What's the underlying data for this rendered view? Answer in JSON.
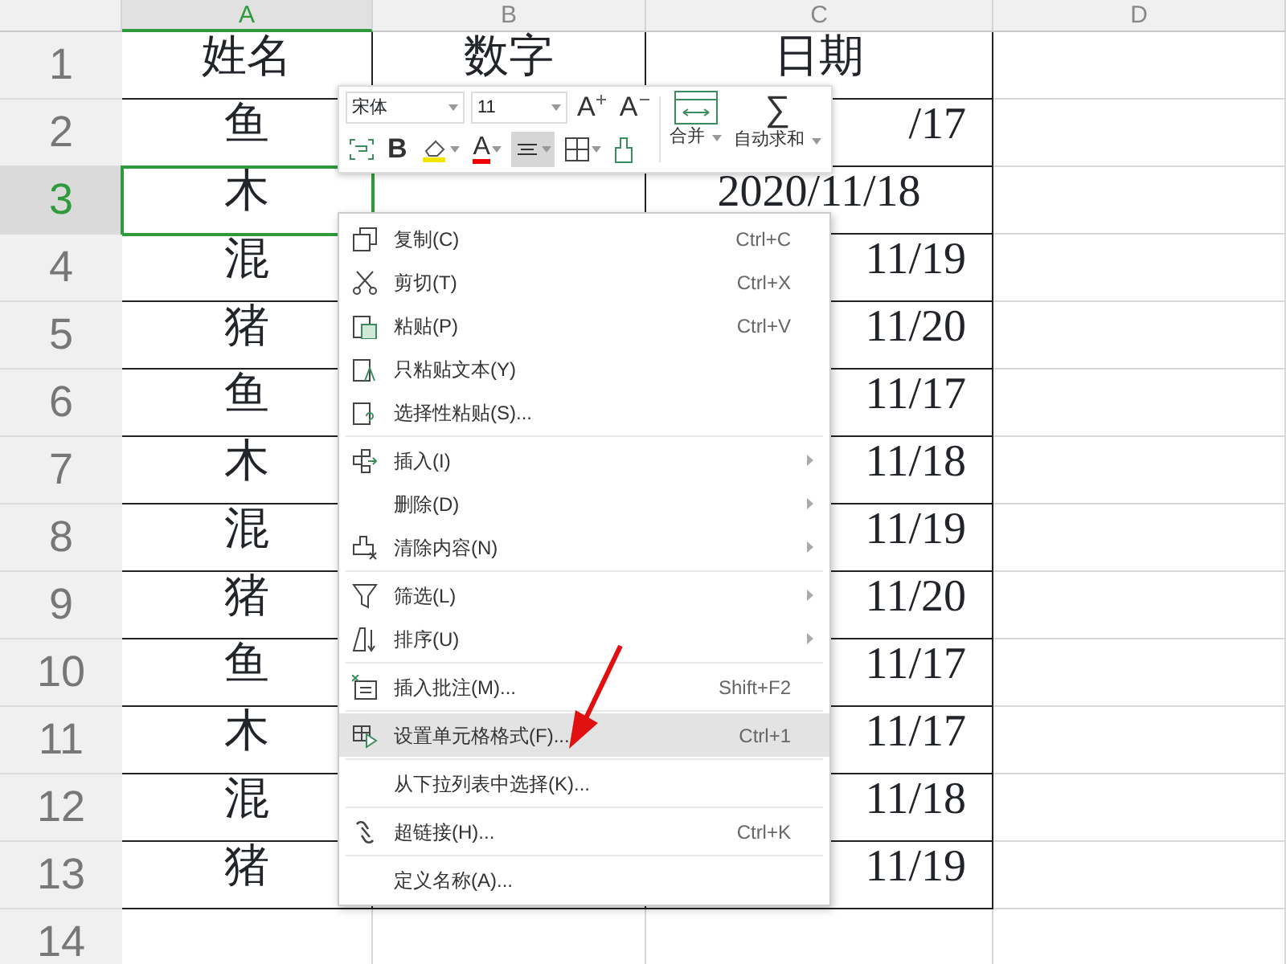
{
  "columns": [
    {
      "label": "A",
      "selected": true
    },
    {
      "label": "B",
      "selected": false
    },
    {
      "label": "C",
      "selected": false
    },
    {
      "label": "D",
      "selected": false
    }
  ],
  "rows": [
    {
      "header": "1",
      "selected": false,
      "cells": [
        {
          "text": "姓名"
        },
        {
          "text": "数字"
        },
        {
          "text": "日期"
        },
        {
          "text": ""
        }
      ]
    },
    {
      "header": "2",
      "selected": false,
      "cells": [
        {
          "text": "鱼"
        },
        {
          "text": ""
        },
        {
          "text": "/17",
          "partial": true
        },
        {
          "text": ""
        }
      ]
    },
    {
      "header": "3",
      "selected": true,
      "cells": [
        {
          "text": "木",
          "selected": true
        },
        {
          "text": ""
        },
        {
          "text": "2020/11/18"
        },
        {
          "text": ""
        }
      ]
    },
    {
      "header": "4",
      "selected": false,
      "cells": [
        {
          "text": "混"
        },
        {
          "text": ""
        },
        {
          "text": "11/19",
          "partial": true
        },
        {
          "text": ""
        }
      ]
    },
    {
      "header": "5",
      "selected": false,
      "cells": [
        {
          "text": "猪"
        },
        {
          "text": ""
        },
        {
          "text": "11/20",
          "partial": true
        },
        {
          "text": ""
        }
      ]
    },
    {
      "header": "6",
      "selected": false,
      "cells": [
        {
          "text": "鱼"
        },
        {
          "text": ""
        },
        {
          "text": "11/17",
          "partial": true
        },
        {
          "text": ""
        }
      ]
    },
    {
      "header": "7",
      "selected": false,
      "cells": [
        {
          "text": "木"
        },
        {
          "text": ""
        },
        {
          "text": "11/18",
          "partial": true
        },
        {
          "text": ""
        }
      ]
    },
    {
      "header": "8",
      "selected": false,
      "cells": [
        {
          "text": "混"
        },
        {
          "text": ""
        },
        {
          "text": "11/19",
          "partial": true
        },
        {
          "text": ""
        }
      ]
    },
    {
      "header": "9",
      "selected": false,
      "cells": [
        {
          "text": "猪"
        },
        {
          "text": ""
        },
        {
          "text": "11/20",
          "partial": true
        },
        {
          "text": ""
        }
      ]
    },
    {
      "header": "10",
      "selected": false,
      "cells": [
        {
          "text": "鱼"
        },
        {
          "text": ""
        },
        {
          "text": "11/17",
          "partial": true
        },
        {
          "text": ""
        }
      ]
    },
    {
      "header": "11",
      "selected": false,
      "cells": [
        {
          "text": "木"
        },
        {
          "text": ""
        },
        {
          "text": "11/17",
          "partial": true
        },
        {
          "text": ""
        }
      ]
    },
    {
      "header": "12",
      "selected": false,
      "cells": [
        {
          "text": "混"
        },
        {
          "text": ""
        },
        {
          "text": "11/18",
          "partial": true
        },
        {
          "text": ""
        }
      ]
    },
    {
      "header": "13",
      "selected": false,
      "cells": [
        {
          "text": "猪"
        },
        {
          "text": ""
        },
        {
          "text": "11/19",
          "partial": true
        },
        {
          "text": ""
        }
      ]
    },
    {
      "header": "14",
      "selected": false,
      "cells": [
        {
          "text": ""
        },
        {
          "text": ""
        },
        {
          "text": ""
        },
        {
          "text": ""
        }
      ]
    }
  ],
  "toolbar": {
    "font_name": "宋体",
    "font_size": "11",
    "grow_font": "A",
    "shrink_font": "A",
    "bold": "B",
    "font_color": "A",
    "align_center_selected": true,
    "merge": "合并",
    "sum_symbol": "∑",
    "autosum": "自动求和"
  },
  "context_menu": [
    [
      {
        "kind": "copy",
        "label": "复制(C)",
        "shortcut": "Ctrl+C",
        "submenu": false,
        "selected": false
      },
      {
        "kind": "cut",
        "label": "剪切(T)",
        "shortcut": "Ctrl+X",
        "submenu": false,
        "selected": false
      },
      {
        "kind": "paste",
        "label": "粘贴(P)",
        "shortcut": "Ctrl+V",
        "submenu": false,
        "selected": false
      },
      {
        "kind": "paste-text",
        "label": "只粘贴文本(Y)",
        "submenu": false,
        "selected": false
      },
      {
        "kind": "paste-special",
        "label": "选择性粘贴(S)...",
        "submenu": false,
        "selected": false
      }
    ],
    [
      {
        "kind": "insert",
        "label": "插入(I)",
        "submenu": true,
        "selected": false
      },
      {
        "kind": "plain",
        "label": "删除(D)",
        "submenu": true,
        "selected": false
      },
      {
        "kind": "clear",
        "label": "清除内容(N)",
        "submenu": true,
        "selected": false
      }
    ],
    [
      {
        "kind": "filter",
        "label": "筛选(L)",
        "submenu": true,
        "selected": false
      },
      {
        "kind": "sort",
        "label": "排序(U)",
        "submenu": true,
        "selected": false
      }
    ],
    [
      {
        "kind": "comment",
        "label": "插入批注(M)...",
        "shortcut": "Shift+F2",
        "submenu": false,
        "selected": false
      }
    ],
    [
      {
        "kind": "format",
        "label": "设置单元格格式(F)...",
        "shortcut": "Ctrl+1",
        "submenu": false,
        "selected": true
      }
    ],
    [
      {
        "kind": "plain",
        "label": "从下拉列表中选择(K)...",
        "submenu": false,
        "selected": false
      }
    ],
    [
      {
        "kind": "link",
        "label": "超链接(H)...",
        "shortcut": "Ctrl+K",
        "submenu": false,
        "selected": false
      }
    ],
    [
      {
        "kind": "plain",
        "label": "定义名称(A)...",
        "submenu": false,
        "selected": false
      }
    ]
  ],
  "annotation_arrow": true
}
